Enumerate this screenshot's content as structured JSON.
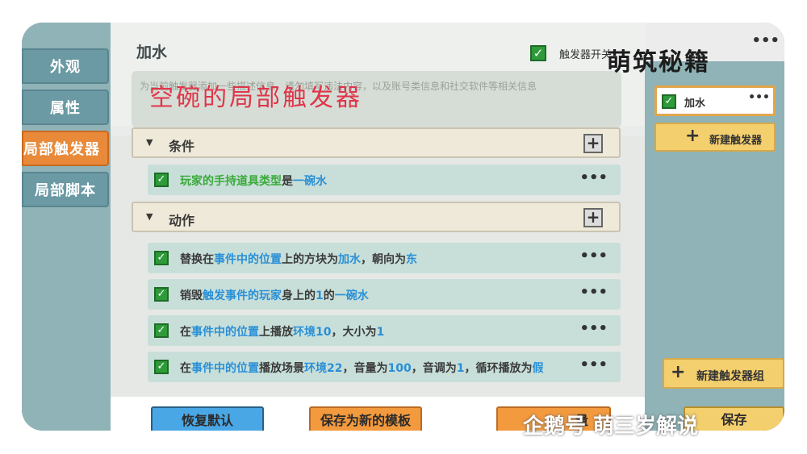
{
  "left_nav": {
    "tabs": [
      {
        "label": "外观"
      },
      {
        "label": "属性"
      },
      {
        "label": "局部触发器"
      },
      {
        "label": "局部脚本"
      }
    ]
  },
  "header": {
    "title": "加水",
    "switch_label": "触发器开关",
    "description": "为当前触发器添加一些描述信息，请勿填写违法内容，以及账号类信息和社交软件等相关信息",
    "overlay_caption": "空碗的局部触发器",
    "brand_watermark": "萌筑秘籍"
  },
  "sections": {
    "condition": {
      "label": "条件"
    },
    "action": {
      "label": "动作"
    }
  },
  "conditions": [
    {
      "segments": [
        {
          "text": "玩家的手持道具类型",
          "style": "green"
        },
        {
          "text": "是",
          "style": "plain"
        },
        {
          "text": "一碗水",
          "style": "blue"
        }
      ]
    }
  ],
  "actions": [
    {
      "segments": [
        {
          "text": "替换在",
          "style": "plain"
        },
        {
          "text": "事件中的位置",
          "style": "blue"
        },
        {
          "text": "上的方块为",
          "style": "plain"
        },
        {
          "text": "加水",
          "style": "blue"
        },
        {
          "text": "，朝向为",
          "style": "plain"
        },
        {
          "text": "东",
          "style": "blue"
        }
      ]
    },
    {
      "segments": [
        {
          "text": "销毁",
          "style": "plain"
        },
        {
          "text": "触发事件的玩家",
          "style": "blue"
        },
        {
          "text": "身上的",
          "style": "plain"
        },
        {
          "text": "1",
          "style": "blue"
        },
        {
          "text": "的",
          "style": "plain"
        },
        {
          "text": "一碗水",
          "style": "blue"
        }
      ]
    },
    {
      "segments": [
        {
          "text": "在",
          "style": "plain"
        },
        {
          "text": "事件中的位置",
          "style": "blue"
        },
        {
          "text": "上播放",
          "style": "plain"
        },
        {
          "text": "环境10",
          "style": "blue"
        },
        {
          "text": "，大小为",
          "style": "plain"
        },
        {
          "text": "1",
          "style": "blue"
        }
      ]
    },
    {
      "segments": [
        {
          "text": "在",
          "style": "plain"
        },
        {
          "text": "事件中的位置",
          "style": "blue"
        },
        {
          "text": "播放场景",
          "style": "plain"
        },
        {
          "text": "环境22",
          "style": "blue"
        },
        {
          "text": "，音量为",
          "style": "plain"
        },
        {
          "text": "100",
          "style": "blue"
        },
        {
          "text": "，音调为",
          "style": "plain"
        },
        {
          "text": "1",
          "style": "blue"
        },
        {
          "text": "，循环播放为",
          "style": "plain"
        },
        {
          "text": "假",
          "style": "blue"
        }
      ]
    }
  ],
  "bottom_bar": {
    "reset_label": "恢复默认",
    "save_template_label": "保存为新的模板",
    "third_label": "量",
    "save_label": "保存"
  },
  "right_panel": {
    "trigger_item_label": "加水",
    "new_trigger_label": "新建触发器",
    "new_group_label": "新建触发器组"
  },
  "footer_watermark": "企鹅号 萌三岁解说",
  "colors": {
    "active_tab": "#e88a3a",
    "accent_blue": "#2a8fd6",
    "accent_green": "#3aaa3a",
    "checkbox_green": "#2f9a3a",
    "button_yellow": "#f4cf6e",
    "button_blue": "#4aa7e6",
    "button_orange": "#f39a3e"
  },
  "icons": {
    "checkbox": "check-mark",
    "more": "ellipsis",
    "add": "plus"
  }
}
